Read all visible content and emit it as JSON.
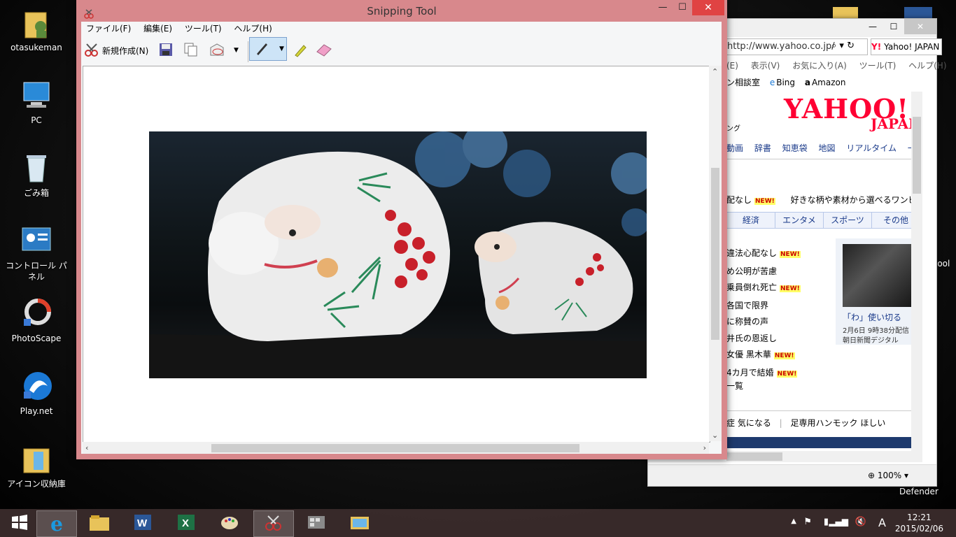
{
  "desktop": {
    "icons": [
      {
        "label": "otasukeman",
        "icon": "user-folder-icon"
      },
      {
        "label": "PC",
        "icon": "computer-icon"
      },
      {
        "label": "ごみ箱",
        "icon": "recycle-bin-icon"
      },
      {
        "label": "コントロール パネル",
        "icon": "control-panel-icon"
      },
      {
        "label": "PhotoScape",
        "icon": "photoscape-icon"
      },
      {
        "label": "Play.net",
        "icon": "playnet-icon"
      },
      {
        "label": "アイコン収納庫",
        "icon": "folder-icon"
      }
    ],
    "right_edge_text": [
      "lool",
      "Defender"
    ]
  },
  "snipping_tool": {
    "title": "Snipping Tool",
    "menus": [
      "ファイル(F)",
      "編集(E)",
      "ツール(T)",
      "ヘルプ(H)"
    ],
    "new_button_label": "新規作成(N)",
    "tools": [
      "save-icon",
      "copy-icon",
      "send-email-icon",
      "pen-icon",
      "highlighter-icon",
      "eraser-icon"
    ],
    "window_controls": {
      "minimize": "—",
      "maximize": "☐",
      "close": "✕"
    }
  },
  "browser": {
    "address": "http://www.yahoo.co.jp/",
    "tab_label": "Yahoo! JAPAN",
    "menubar": [
      "(E)",
      "表示(V)",
      "お気に入り(A)",
      "ツール(T)",
      "ヘルプ(H)"
    ],
    "favorites": [
      "ン相談室",
      "Bing",
      "Amazon"
    ],
    "logo": "YAHOO!",
    "logo_sub": "JAPAN",
    "logo_side": "ング",
    "nav": [
      "動画",
      "辞書",
      "知恵袋",
      "地図",
      "リアルタイム",
      "一覧"
    ],
    "promo": [
      "配なし",
      "好きな柄や素材から選べるワンピー"
    ],
    "tabs": [
      "経済",
      "エンタメ",
      "スポーツ",
      "その他"
    ],
    "news": [
      "違法心配なし",
      "め公明が苦慮",
      "乗員倒れ死亡",
      "各国で限界",
      "に称賛の声",
      "井氏の恩返し",
      "女優 黒木華",
      "4カ月で結婚"
    ],
    "photo_caption": "「わ」使い切る",
    "photo_meta": [
      "2月6日 9時38分配信",
      "朝日新聞デジタル"
    ],
    "more": "一覧",
    "search_suggest": [
      "症 気になる",
      "足専用ハンモック ほしい"
    ],
    "zoom": "100%",
    "new_badge": "NEW!"
  },
  "taskbar": {
    "items": [
      "start-icon",
      "internet-explorer-icon",
      "file-explorer-icon",
      "word-icon",
      "excel-icon",
      "paint-icon",
      "snipping-tool-icon",
      "other-app-icon",
      "photo-app-icon"
    ],
    "tray_lang": "A",
    "clock_time": "12:21",
    "clock_date": "2015/02/06"
  }
}
